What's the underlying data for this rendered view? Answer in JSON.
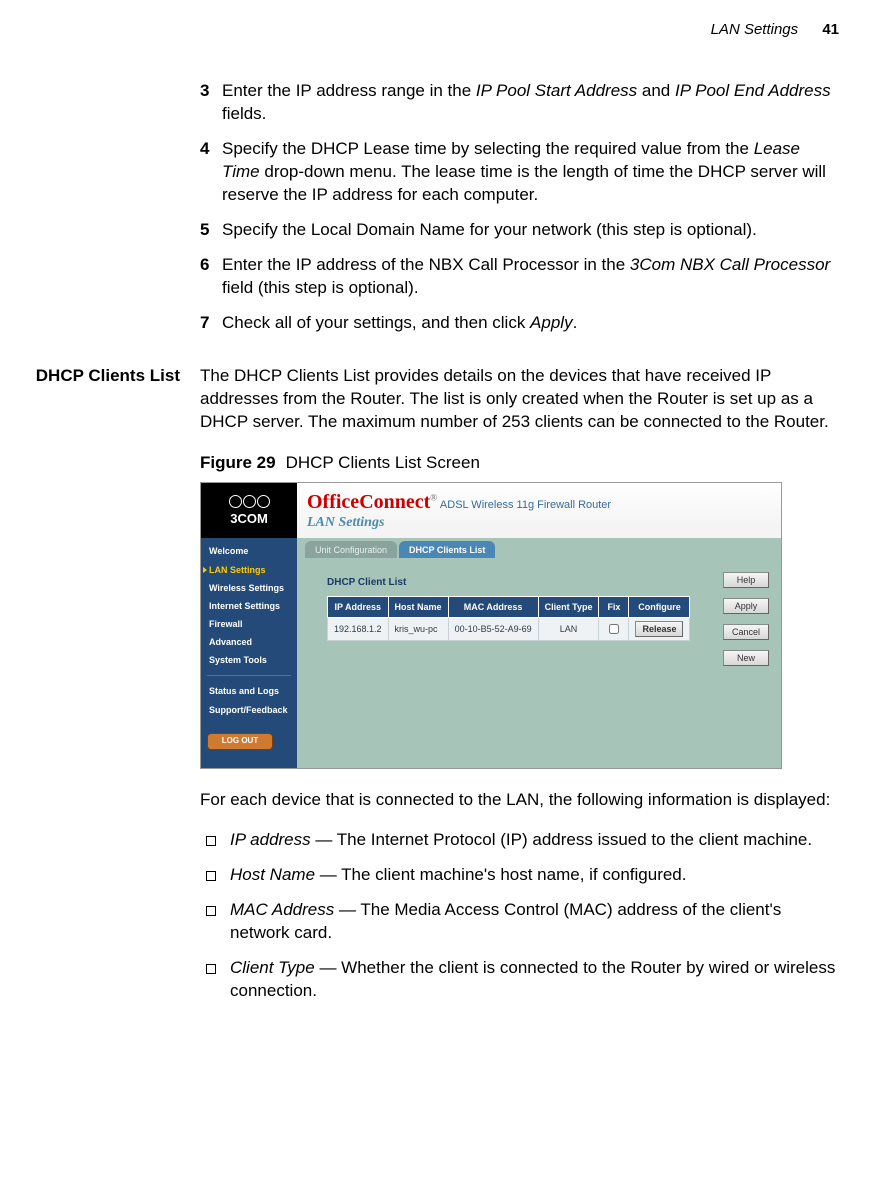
{
  "header": {
    "section": "LAN Settings",
    "page": "41"
  },
  "steps": {
    "s3": {
      "num": "3",
      "t1": "Enter the IP address range in the ",
      "i1": "IP Pool Start Address",
      "t2": " and ",
      "i2": "IP Pool End Address",
      "t3": " fields."
    },
    "s4": {
      "num": "4",
      "t1": "Specify the DHCP Lease time by selecting the required value from the ",
      "i1": "Lease Time",
      "t2": " drop-down menu. The lease time is the length of time the DHCP server will reserve the IP address for each computer."
    },
    "s5": {
      "num": "5",
      "t1": "Specify the Local Domain Name for your network (this step is optional)."
    },
    "s6": {
      "num": "6",
      "t1": "Enter the IP address of the NBX Call Processor in the ",
      "i1": "3Com NBX Call Processor",
      "t2": " field (this step is optional)."
    },
    "s7": {
      "num": "7",
      "t1": "Check all of your settings, and then click ",
      "i1": "Apply",
      "t2": "."
    }
  },
  "section": {
    "label": "DHCP Clients List",
    "intro": "The DHCP Clients List provides details on the devices that have received IP addresses from the Router. The list is only created when the Router is set up as a DHCP server. The maximum number of 253 clients can be connected to the Router."
  },
  "figure": {
    "label": "Figure 29",
    "caption": "DHCP Clients List Screen"
  },
  "router": {
    "brand3com": "3COM",
    "oc": "OfficeConnect",
    "oc_sub": "ADSL Wireless 11g Firewall Router",
    "lan_settings": "LAN Settings",
    "tabs": {
      "unit": "Unit Configuration",
      "dhcp": "DHCP Clients List"
    },
    "panel_title": "DHCP Client List",
    "table": {
      "h_ip": "IP Address",
      "h_host": "Host Name",
      "h_mac": "MAC Address",
      "h_type": "Client Type",
      "h_fix": "Fix",
      "h_conf": "Configure",
      "row": {
        "ip": "192.168.1.2",
        "host": "kris_wu-pc",
        "mac": "00-10-B5-52-A9-69",
        "type": "LAN",
        "release": "Release"
      }
    },
    "nav": {
      "welcome": "Welcome",
      "lan": "LAN Settings",
      "wireless": "Wireless Settings",
      "internet": "Internet Settings",
      "firewall": "Firewall",
      "advanced": "Advanced",
      "tools": "System Tools",
      "status": "Status and Logs",
      "support": "Support/Feedback",
      "logout": "LOG OUT"
    },
    "buttons": {
      "help": "Help",
      "apply": "Apply",
      "cancel": "Cancel",
      "new": "New"
    }
  },
  "postfig": "For each device that is connected to the LAN, the following information is displayed:",
  "bullets": {
    "b1": {
      "term": "IP address",
      "desc": " — The Internet Protocol (IP) address issued to the client machine."
    },
    "b2": {
      "term": "Host Name",
      "desc": " — The client machine's host name, if configured."
    },
    "b3": {
      "term": "MAC Address",
      "desc": " — The Media Access Control (MAC) address of the client's network card."
    },
    "b4": {
      "term": "Client Type",
      "desc": " — Whether the client is connected to the Router by wired or wireless connection."
    }
  }
}
